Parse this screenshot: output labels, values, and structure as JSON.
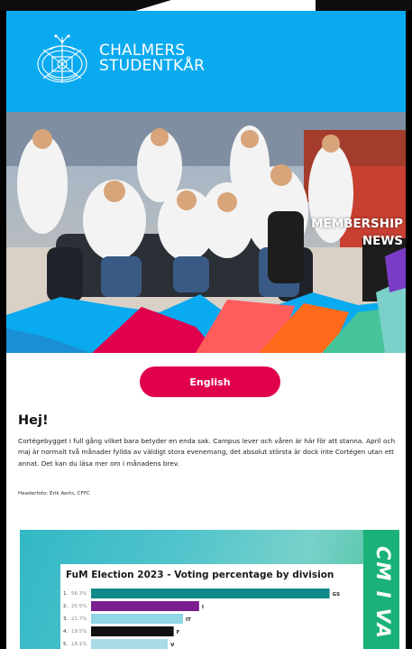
{
  "header": {
    "logo_line1": "CHALMERS",
    "logo_line2": "STUDENTKÅR",
    "brand_color": "#0aaaf0"
  },
  "hero": {
    "title_line1": "MEMBERSHIP",
    "title_line2": "NEWS"
  },
  "language_button": {
    "label": "English",
    "color": "#e0004d"
  },
  "content": {
    "greeting": "Hej!",
    "intro": "Cortégebygget i full gång vilket bara betyder en enda sak. Campus lever och våren är här för att stanna. April och maj är normalt två månader fyllda av väldigt stora evenemang, det absolut största är dock inte Cortégen utan ett annat. Det kan du läsa mer om i månadens brev.",
    "photo_credit": "Headerfoto: Erik Aerts, CFFC"
  },
  "election_banner": {
    "vertical_text": "CM I VA"
  },
  "chart_data": {
    "type": "bar",
    "title": "FuM Election 2023 - Voting percentage by division",
    "categories": [
      "GS",
      "I",
      "IT",
      "F",
      "V"
    ],
    "ranks": [
      "1.",
      "2.",
      "3.",
      "4.",
      "5."
    ],
    "values": [
      56.3,
      25.5,
      21.7,
      19.5,
      18.1
    ],
    "value_labels": [
      "56.3%",
      "25.5%",
      "21.7%",
      "19.5%",
      "18.1%"
    ],
    "colors": [
      "#12898a",
      "#7b1f8f",
      "#8fd6e6",
      "#111111",
      "#a9dbe7"
    ],
    "xlim": [
      0,
      60
    ]
  }
}
